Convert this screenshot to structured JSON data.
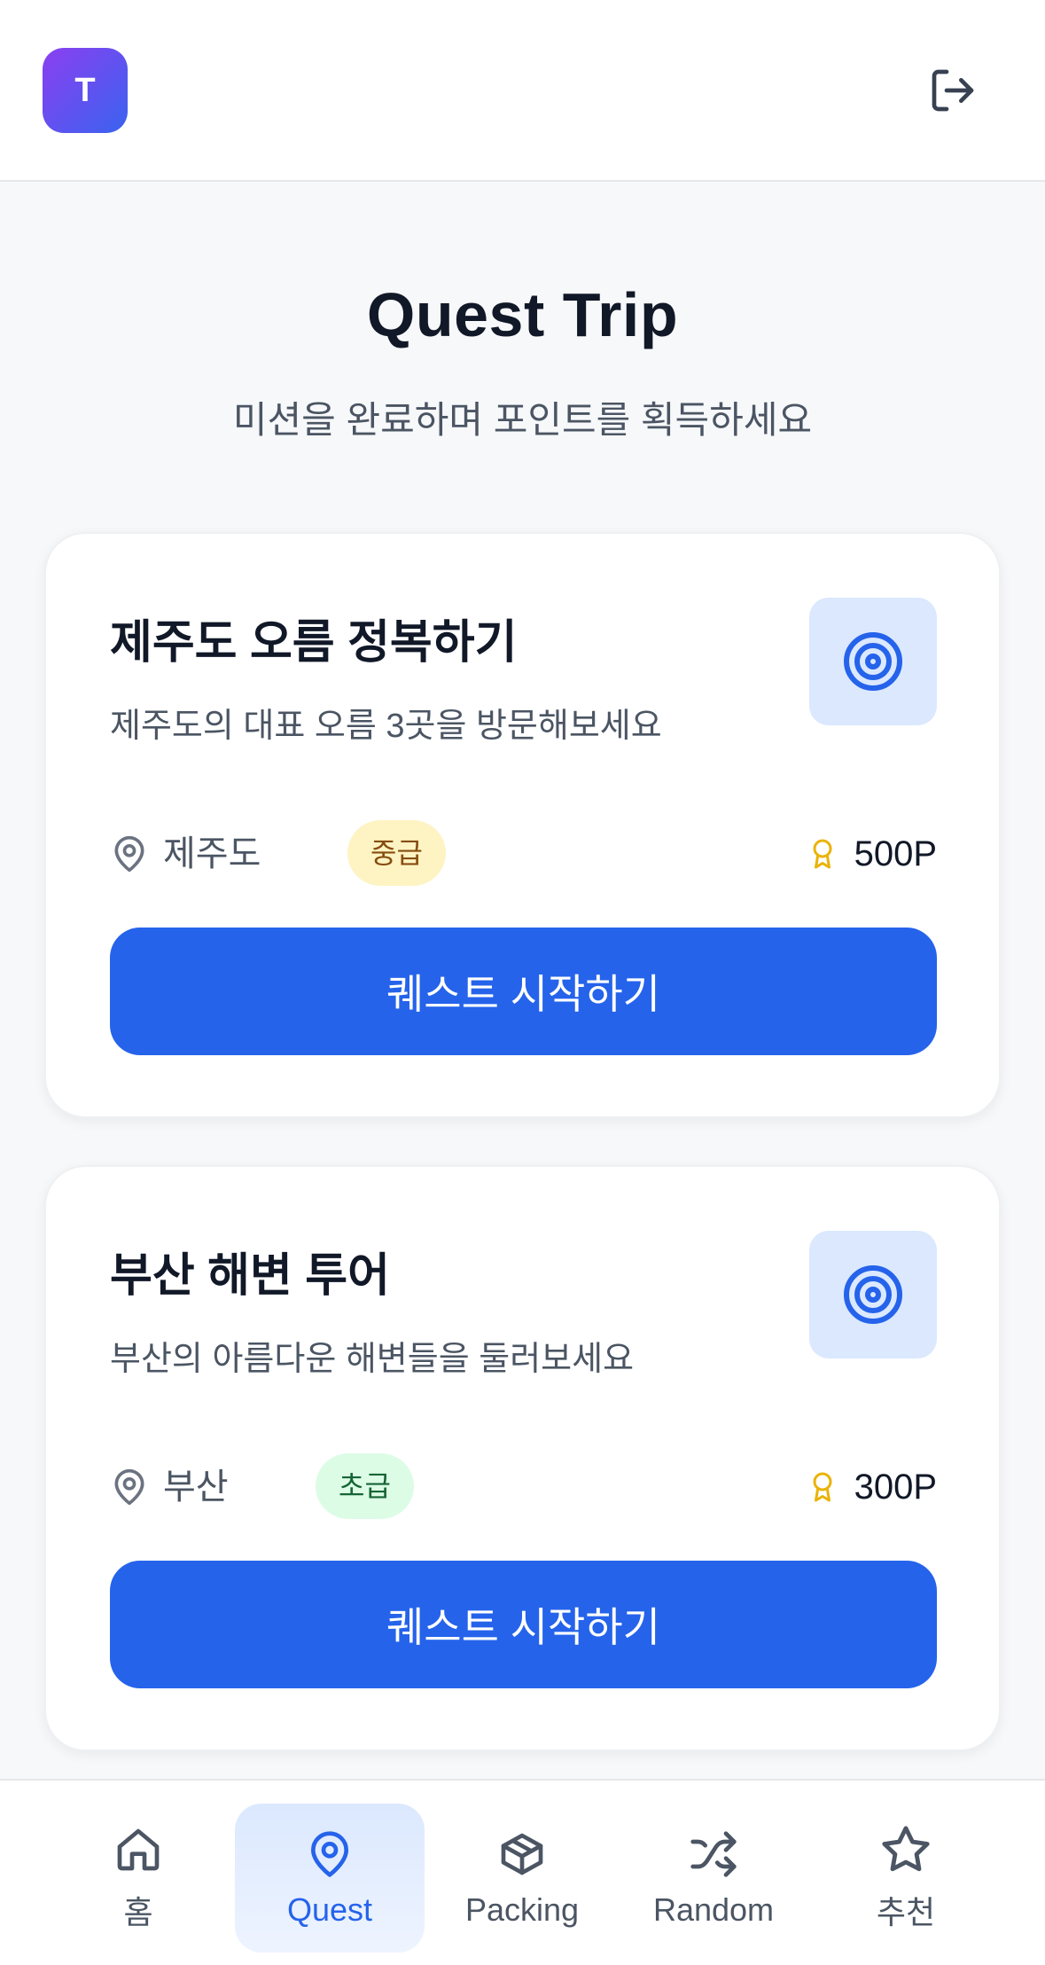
{
  "header": {
    "avatar_letter": "T",
    "logout_icon": "logout-icon"
  },
  "page": {
    "title": "Quest Trip",
    "subtitle": "미션을 완료하며 포인트를 획득하세요"
  },
  "quests": [
    {
      "title": "제주도 오름 정복하기",
      "description": "제주도의 대표 오름 3곳을 방문해보세요",
      "location": "제주도",
      "difficulty": "중급",
      "points": "500P",
      "button_label": "퀘스트 시작하기",
      "icon": "target-icon"
    },
    {
      "title": "부산 해변 투어",
      "description": "부산의 아름다운 해변들을 둘러보세요",
      "location": "부산",
      "difficulty": "초급",
      "points": "300P",
      "button_label": "퀘스트 시작하기",
      "icon": "target-icon"
    }
  ],
  "nav": {
    "items": [
      {
        "label": "홈",
        "icon": "home-icon"
      },
      {
        "label": "Quest",
        "icon": "map-pin-icon",
        "active": true
      },
      {
        "label": "Packing",
        "icon": "package-icon"
      },
      {
        "label": "Random",
        "icon": "shuffle-icon"
      },
      {
        "label": "추천",
        "icon": "star-icon"
      }
    ]
  },
  "colors": {
    "primary": "#2563eb",
    "target_bg": "#dbe8fe",
    "badge_mid_bg": "#fef3c3",
    "badge_easy_bg": "#dcfce6",
    "award": "#eab308"
  }
}
